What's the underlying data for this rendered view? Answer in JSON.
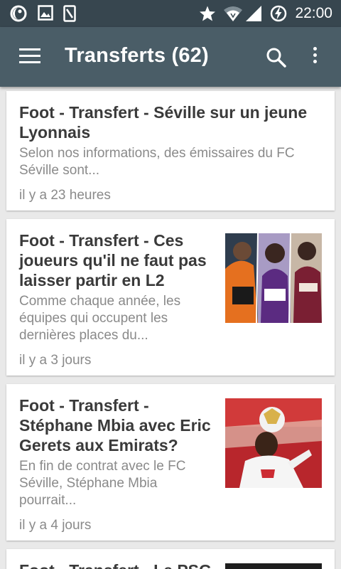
{
  "status_bar": {
    "time": "22:00",
    "left_icons": [
      "night-mode-icon",
      "image-icon",
      "phone-icon"
    ],
    "right_icons": [
      "star-icon",
      "wifi-icon",
      "signal-icon",
      "battery-charging-icon"
    ]
  },
  "toolbar": {
    "title": "Transferts (62)",
    "menu_icon": "hamburger-menu-icon",
    "search_icon": "search-icon",
    "more_icon": "more-vertical-icon"
  },
  "colors": {
    "status_bar": "#37464f",
    "toolbar": "#4a5d67",
    "background": "#e9e9e9",
    "title_text": "#3a3a3a",
    "secondary_text": "#8a8a8a"
  },
  "articles": [
    {
      "title_lines": [
        "Foot - Transfert - Séville sur un jeune",
        "Lyonnais"
      ],
      "summary_lines": [
        "Selon nos informations, des émissaires du FC",
        "Séville sont..."
      ],
      "time": "il y a 23 heures",
      "has_image": false
    },
    {
      "title_lines": [
        "Foot - Transfert - Ces",
        "joueurs qu'il ne faut pas",
        "laisser partir en L2"
      ],
      "summary_lines": [
        "Comme chaque année, les",
        "équipes qui occupent les",
        "dernières places du..."
      ],
      "time": "il y a 3 jours",
      "has_image": true
    },
    {
      "title_lines": [
        "Foot - Transfert -",
        "Stéphane Mbia avec Eric",
        "Gerets aux Emirats?"
      ],
      "summary_lines": [
        "En fin de contrat avec le FC",
        "Séville, Stéphane Mbia",
        "pourrait..."
      ],
      "time": "il y a 4 jours",
      "has_image": true
    },
    {
      "title_lines": [
        "Foot - Transfert - Le PSG"
      ],
      "summary_lines": [],
      "time": "",
      "has_image": true
    }
  ]
}
